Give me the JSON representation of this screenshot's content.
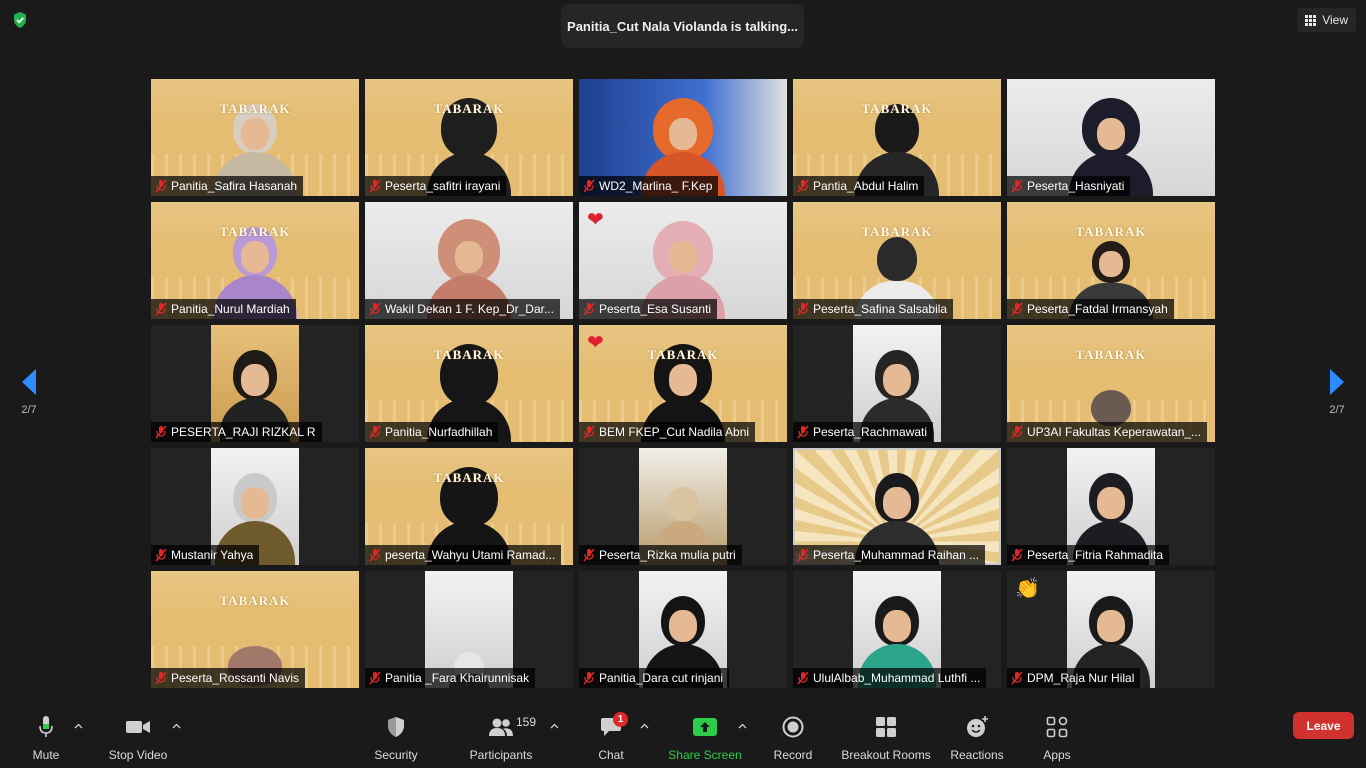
{
  "top": {
    "talking": "Panitia_Cut Nala Violanda is talking...",
    "view_label": "View"
  },
  "nav": {
    "page": "2/7"
  },
  "tiles": [
    {
      "name": "Panitia_Safira Hasanah"
    },
    {
      "name": "Peserta_safitri irayani"
    },
    {
      "name": "WD2_Marlina_ F.Kep"
    },
    {
      "name": "Pantia_Abdul Halim"
    },
    {
      "name": "Peserta_Hasniyati"
    },
    {
      "name": "Panitia_Nurul Mardiah"
    },
    {
      "name": "Wakil Dekan 1 F. Kep_Dr_Dar..."
    },
    {
      "name": "Peserta_Esa Susanti"
    },
    {
      "name": "Peserta_Safina Salsabila"
    },
    {
      "name": "Peserta_Fatdal Irmansyah"
    },
    {
      "name": "PESERTA_RAJI RIZKAL R"
    },
    {
      "name": "Panitia_Nurfadhillah"
    },
    {
      "name": "BEM FKEP_Cut Nadila Abni"
    },
    {
      "name": "Peserta_Rachmawati"
    },
    {
      "name": "UP3AI Fakultas Keperawatan_..."
    },
    {
      "name": "Mustanir Yahya"
    },
    {
      "name": "peserta_Wahyu Utami Ramad..."
    },
    {
      "name": "Peserta_Rizka mulia putri"
    },
    {
      "name": "Peserta_Muhammad Raihan ..."
    },
    {
      "name": "Peserta_Fitria Rahmadita"
    },
    {
      "name": "Peserta_Rossanti Navis"
    },
    {
      "name": "Panitia _Fara Khairunnisak"
    },
    {
      "name": "Panitia_Dara cut rinjani"
    },
    {
      "name": "UlulAlbab_Muhammad Luthfi ..."
    },
    {
      "name": "DPM_Raja Nur Hilal"
    }
  ],
  "toolbar": {
    "mute": "Mute",
    "stop_video": "Stop Video",
    "security": "Security",
    "participants": "Participants",
    "participants_count": "159",
    "chat": "Chat",
    "chat_badge": "1",
    "share_screen": "Share Screen",
    "record": "Record",
    "breakout_rooms": "Breakout Rooms",
    "reactions": "Reactions",
    "apps": "Apps",
    "leave": "Leave"
  },
  "colors": {
    "background": "#1a1a1a",
    "share_green": "#2ecc4a",
    "leave_red": "#d0312d",
    "mic_muted_red": "#e02828",
    "banner_gold": "#e4bd72"
  }
}
